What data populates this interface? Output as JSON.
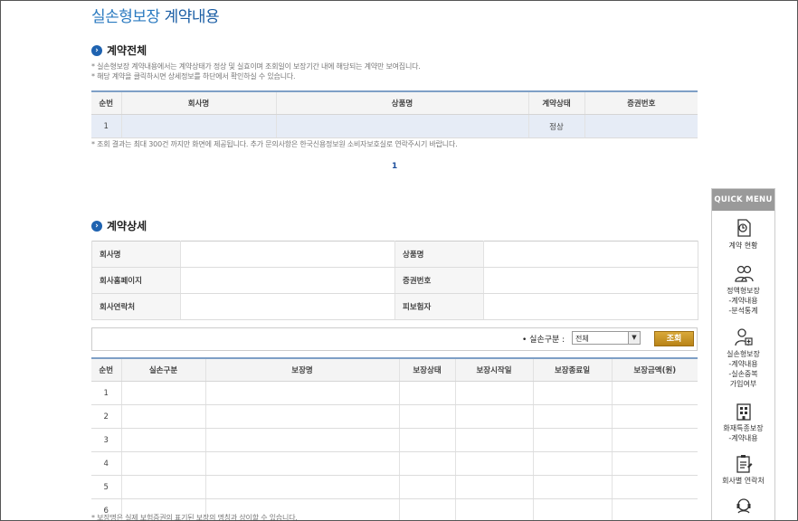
{
  "page": {
    "title_a": "실손형보장",
    "title_b": "계약내용"
  },
  "contract_all": {
    "heading": "계약전체",
    "notes": [
      "* 실손형보장 계약내용에서는 계약상태가 정상 및 실효이며 조회일이 보장기간 내에 해당되는 계약만 보여집니다.",
      "* 해당 계약을 클릭하시면 상세정보를 하단에서 확인하실 수 있습니다."
    ],
    "columns": [
      "순번",
      "회사명",
      "상품명",
      "계약상태",
      "증권번호"
    ],
    "rows": [
      [
        "1",
        "",
        "",
        "정상",
        ""
      ]
    ],
    "footnote": "* 조회 결과는 최대 300건 까지만 화면에 제공됩니다. 추가 문의사항은 한국신용정보원 소비자보호실로 연락주시기 바랍니다.",
    "page_number": "1"
  },
  "contract_detail": {
    "heading": "계약상세",
    "rows": [
      {
        "l1": "회사명",
        "v1": "",
        "l2": "상품명",
        "v2": ""
      },
      {
        "l1": "회사홈페이지",
        "v1": "",
        "l2": "증권번호",
        "v2": ""
      },
      {
        "l1": "회사연락처",
        "v1": "",
        "l2": "피보험자",
        "v2": ""
      }
    ]
  },
  "search": {
    "label": "• 실손구분 :",
    "selected": "전체",
    "button": "조회"
  },
  "coverage": {
    "columns": [
      "순번",
      "실손구분",
      "보장명",
      "보장상태",
      "보장시작일",
      "보장종료일",
      "보장금액(원)"
    ],
    "rows": [
      [
        "1",
        "",
        "",
        "",
        "",
        "",
        ""
      ],
      [
        "2",
        "",
        "",
        "",
        "",
        "",
        ""
      ],
      [
        "3",
        "",
        "",
        "",
        "",
        "",
        ""
      ],
      [
        "4",
        "",
        "",
        "",
        "",
        "",
        ""
      ],
      [
        "5",
        "",
        "",
        "",
        "",
        "",
        ""
      ],
      [
        "6",
        "",
        "",
        "",
        "",
        "",
        ""
      ]
    ],
    "footnote": "* 보장명은 실제 보험증권의 표기된 보장의 명칭과 상이할 수 있습니다."
  },
  "quick_menu": {
    "title": "QUICK MENU",
    "items": [
      {
        "icon": "contract-status-icon",
        "lines": [
          "계약 현황"
        ]
      },
      {
        "icon": "people-icon",
        "lines": [
          "정액형보장",
          "-계약내용",
          "-분석통계"
        ]
      },
      {
        "icon": "person-medical-icon",
        "lines": [
          "실손형보장",
          "-계약내용",
          "-실손중복",
          "가입여부"
        ]
      },
      {
        "icon": "building-icon",
        "lines": [
          "화재특종보장",
          "-계약내용"
        ]
      },
      {
        "icon": "clipboard-icon",
        "lines": [
          "회사별 연락처"
        ]
      },
      {
        "icon": "headset-icon",
        "lines": []
      }
    ]
  }
}
